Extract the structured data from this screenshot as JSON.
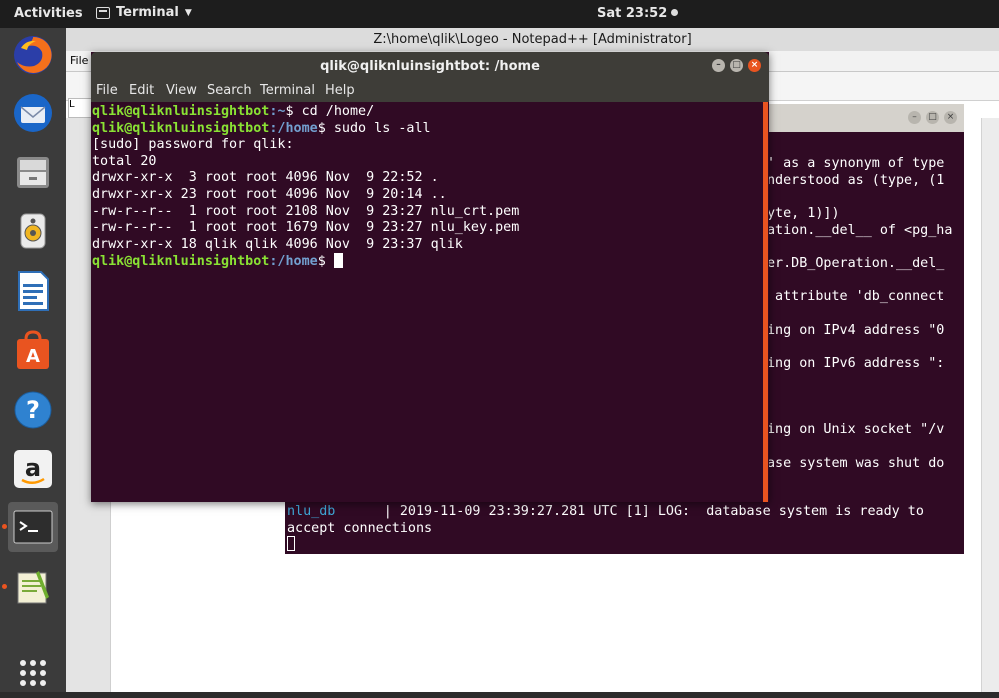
{
  "topbar": {
    "activities": "Activities",
    "app_name": "Terminal",
    "clock": "Sat 23:52"
  },
  "dock": {
    "items": [
      {
        "name": "firefox-icon"
      },
      {
        "name": "thunderbird-icon"
      },
      {
        "name": "files-icon"
      },
      {
        "name": "rhythmbox-icon"
      },
      {
        "name": "libreoffice-writer-icon"
      },
      {
        "name": "software-center-icon"
      },
      {
        "name": "help-icon"
      },
      {
        "name": "amazon-icon"
      },
      {
        "name": "terminal-icon"
      },
      {
        "name": "notepadpp-icon"
      },
      {
        "name": "app-grid-icon"
      }
    ]
  },
  "notepadpp": {
    "title": "Z:\\home\\qlik\\Logeo - Notepad++ [Administrator]",
    "menu_file": "File",
    "tab_label": "L"
  },
  "terminal_main": {
    "title": "qlik@qliknluinsightbot: /home",
    "menu": [
      "File",
      "Edit",
      "View",
      "Search",
      "Terminal",
      "Help"
    ],
    "prompt_user": "qlik@qliknluinsightbot",
    "lines": [
      {
        "path": ":~",
        "cmd": "$ cd /home/"
      },
      {
        "path": ":/home",
        "cmd": "$ sudo ls -all"
      }
    ],
    "output": [
      "[sudo] password for qlik:",
      "total 20",
      "drwxr-xr-x  3 root root 4096 Nov  9 22:52 .",
      "drwxr-xr-x 23 root root 4096 Nov  9 20:14 ..",
      "-rw-r--r--  1 root root 2108 Nov  9 23:27 nlu_crt.pem",
      "-rw-r--r--  1 root root 1679 Nov  9 23:27 nlu_key.pem",
      "drwxr-xr-x 18 qlik qlik 4096 Nov  9 23:37 qlik"
    ],
    "last_prompt": {
      "path": ":/home",
      "cmd": "$ "
    }
  },
  "terminal_log": {
    "visible_right_lines": [
      "' as a synonym of type",
      "nderstood as (type, (1",
      "",
      "yte, 1)])",
      "ation.__del__ of <pg_ha",
      "",
      "er.DB_Operation.__del_",
      "",
      " attribute 'db_connect",
      "",
      "ing on IPv4 address \"0",
      "",
      "ing on IPv6 address \":",
      "",
      "",
      "",
      "ing on Unix socket \"/v",
      "",
      "ase system was shut do"
    ],
    "log_service": "nlu_db",
    "log_text": "      | 2019-11-09 23:39:27.281 UTC [1] LOG:  database system is ready to",
    "log_cont": "accept connections"
  }
}
